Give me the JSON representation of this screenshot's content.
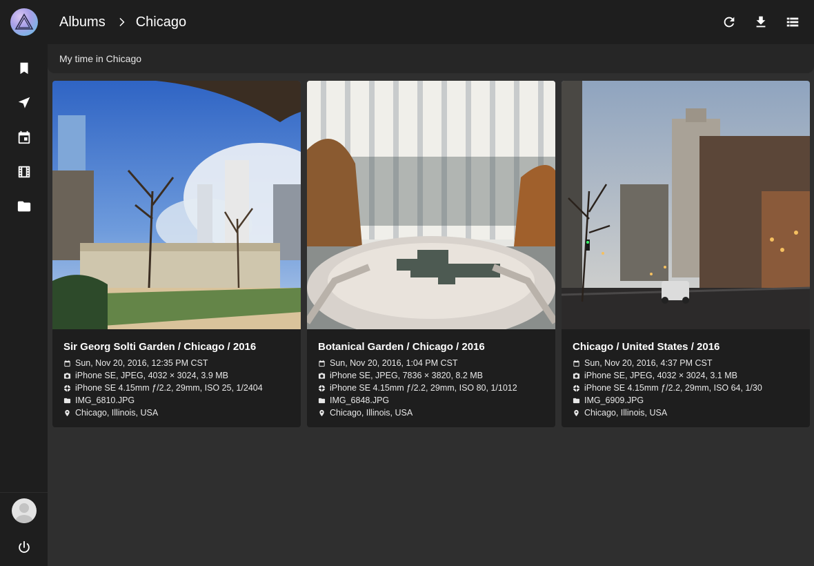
{
  "breadcrumb": {
    "root": "Albums",
    "current": "Chicago"
  },
  "album": {
    "description": "My time in Chicago"
  },
  "sidebar": {
    "items": [
      {
        "name": "bookmark-icon"
      },
      {
        "name": "navigation-icon"
      },
      {
        "name": "calendar-icon"
      },
      {
        "name": "film-icon"
      },
      {
        "name": "folder-icon"
      }
    ]
  },
  "toolbar": {
    "actions": [
      "refresh-icon",
      "download-icon",
      "list-view-icon"
    ]
  },
  "photos": [
    {
      "title": "Sir Georg Solti Garden / Chicago / 2016",
      "date": "Sun, Nov 20, 2016, 12:35 PM CST",
      "file_info": "iPhone SE, JPEG, 4032 × 3024, 3.9 MB",
      "camera": "iPhone SE 4.15mm ƒ/2.2, 29mm, ISO 25, 1/2404",
      "filename": "IMG_6810.JPG",
      "location": "Chicago, Illinois, USA"
    },
    {
      "title": "Botanical Garden / Chicago / 2016",
      "date": "Sun, Nov 20, 2016, 1:04 PM CST",
      "file_info": "iPhone SE, JPEG, 7836 × 3820, 8.2 MB",
      "camera": "iPhone SE 4.15mm ƒ/2.2, 29mm, ISO 80, 1/1012",
      "filename": "IMG_6848.JPG",
      "location": "Chicago, Illinois, USA"
    },
    {
      "title": "Chicago / United States / 2016",
      "date": "Sun, Nov 20, 2016, 4:37 PM CST",
      "file_info": "iPhone SE, JPEG, 4032 × 3024, 3.1 MB",
      "camera": "iPhone SE 4.15mm ƒ/2.2, 29mm, ISO 64, 1/30",
      "filename": "IMG_6909.JPG",
      "location": "Chicago, Illinois, USA"
    }
  ]
}
